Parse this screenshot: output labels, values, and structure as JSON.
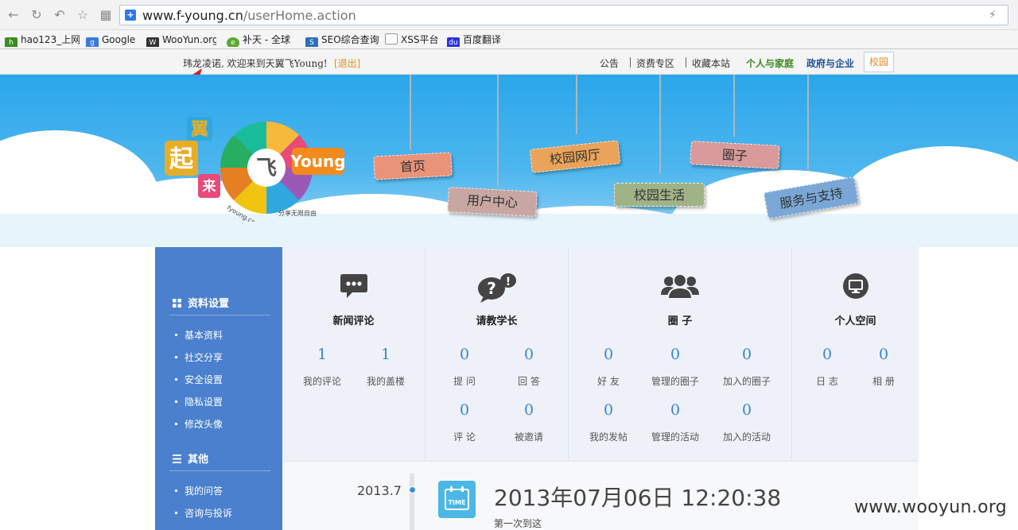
{
  "browser": {
    "url_host": "www.f-young.cn",
    "url_path": "/userHome.action",
    "bookmarks": [
      "hao123_上网",
      "Google",
      "WooYun.org",
      "补天 - 全球",
      "SEO综合查询",
      "XSS平台",
      "百度翻译"
    ]
  },
  "topbar": {
    "welcome": "玮龙凌诺, 欢迎来到天翼飞Young!",
    "logout": "[退出]",
    "links": [
      "公告",
      "资费专区",
      "收藏本站"
    ],
    "personal": "个人与家庭",
    "gov": "政府与企业",
    "campus": "校园",
    "colors": {
      "personal": "#3d8a1f",
      "gov": "#1c4f9a",
      "campus": "#e88b1a"
    }
  },
  "banner": {
    "logo_alt": "翼起来 飞Young fyoung.cn 分享无限自由",
    "nav": [
      "首页",
      "用户中心",
      "校园网厅",
      "校园生活",
      "圈子",
      "服务与支持"
    ]
  },
  "sidebar": {
    "sections": [
      {
        "title": "资料设置",
        "items": [
          "基本资料",
          "社交分享",
          "安全设置",
          "隐私设置",
          "修改头像"
        ]
      },
      {
        "title": "其他",
        "items": [
          "我的问答",
          "咨询与投诉"
        ]
      }
    ]
  },
  "panels": [
    {
      "title": "新闻评论",
      "icon": "chat-bubble-icon",
      "stats": [
        {
          "n": "1",
          "l": "我的评论"
        },
        {
          "n": "1",
          "l": "我的盖楼"
        }
      ]
    },
    {
      "title": "请教学长",
      "icon": "question-bubble-icon",
      "stats": [
        {
          "n": "0",
          "l": "提 问"
        },
        {
          "n": "0",
          "l": "回 答"
        },
        {
          "n": "0",
          "l": "评 论"
        },
        {
          "n": "0",
          "l": "被邀请"
        }
      ]
    },
    {
      "title": "圈 子",
      "icon": "group-icon",
      "stats": [
        {
          "n": "0",
          "l": "好 友"
        },
        {
          "n": "0",
          "l": "管理的圈子"
        },
        {
          "n": "0",
          "l": "加入的圈子"
        },
        {
          "n": "0",
          "l": "我的发帖"
        },
        {
          "n": "0",
          "l": "管理的活动"
        },
        {
          "n": "0",
          "l": "加入的活动"
        }
      ]
    },
    {
      "title": "个人空间",
      "icon": "monitor-icon",
      "stats": [
        {
          "n": "0",
          "l": "日 志"
        },
        {
          "n": "0",
          "l": "相 册"
        }
      ]
    }
  ],
  "timeline": {
    "year": "2013.7",
    "icon_label": "TIME",
    "date": "2013年07月06日 12:20:38",
    "note": "第一次到这"
  },
  "watermark": "www.wooyun.org"
}
